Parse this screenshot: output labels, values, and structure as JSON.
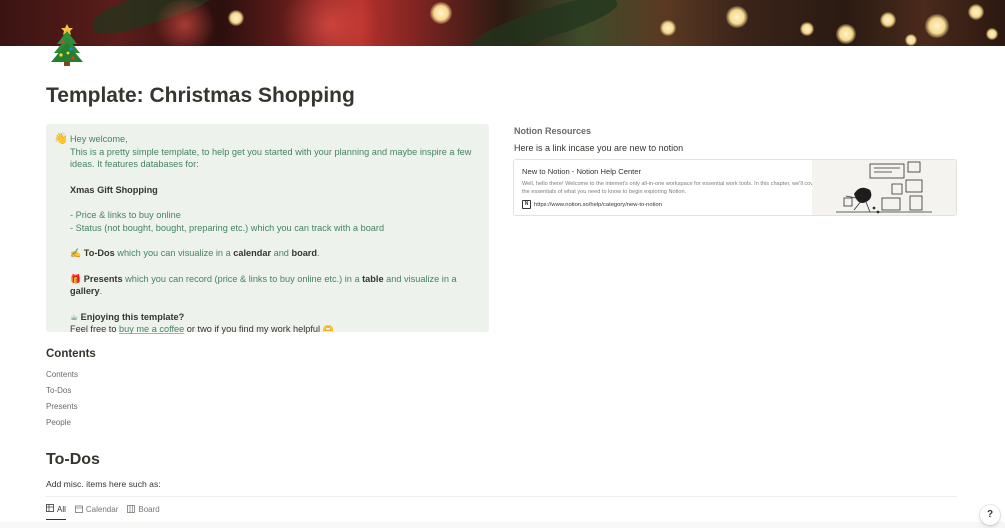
{
  "page": {
    "title": "Template: Christmas Shopping",
    "icon": "christmas-tree-icon"
  },
  "callout": {
    "icon": "waving-hand-icon",
    "greeting": "Hey welcome,",
    "intro": "This is a pretty simple template, to help get you started with your planning and maybe inspire a few ideas. It features databases for:",
    "db_title": "Xmas Gift Shopping",
    "bullet1": "- Price & links to buy online",
    "bullet2": "- Status (not bought, bought, preparing etc.) which you can track with a board",
    "todos_icon": "writing-hand-icon",
    "todos_bold": "To-Dos",
    "todos_text1": " which you can visualize in a ",
    "todos_calendar": "calendar",
    "todos_and": " and ",
    "todos_board": "board",
    "todos_end": ".",
    "presents_icon": "gift-icon",
    "presents_bold": "Presents",
    "presents_text1": " which you can record (price & links to buy online etc.) in a ",
    "presents_table": "table",
    "presents_text2": " and visualize in a ",
    "presents_gallery": "gallery",
    "presents_end": ".",
    "coffee_icon": "coffee-icon",
    "enjoy_bold": "Enjoying this template?",
    "feel_free": "Feel free to ",
    "coffee_link": "buy me a coffee",
    "feel_end": " or two if you find my work helpful ",
    "heart_icon": "heart-hands-icon"
  },
  "resources": {
    "heading": "Notion Resources",
    "subtitle": "Here is a link incase you are new to notion",
    "bookmark": {
      "title": "New to Notion - Notion Help Center",
      "description": "Well, hello there! Welcome to the internet's only all-in-one workspace for essential work tools. In this chapter, we'll cover the essentials of what you need to know to begin exploring Notion.",
      "url": "https://www.notion.so/help/category/new-to-notion",
      "favicon": "notion-icon"
    }
  },
  "contents": {
    "heading": "Contents",
    "items": [
      "Contents",
      "To-Dos",
      "Presents",
      "People"
    ]
  },
  "todos": {
    "heading": "To-Dos",
    "description": "Add misc. items here such as:",
    "views": [
      {
        "label": "All",
        "icon": "table-icon",
        "active": true
      },
      {
        "label": "Calendar",
        "icon": "calendar-icon",
        "active": false
      },
      {
        "label": "Board",
        "icon": "board-icon",
        "active": false
      }
    ]
  },
  "help": {
    "label": "?"
  },
  "colors": {
    "callout_bg": "#edf3ec",
    "callout_text": "#448361",
    "text": "#37352f",
    "muted": "#787774"
  }
}
